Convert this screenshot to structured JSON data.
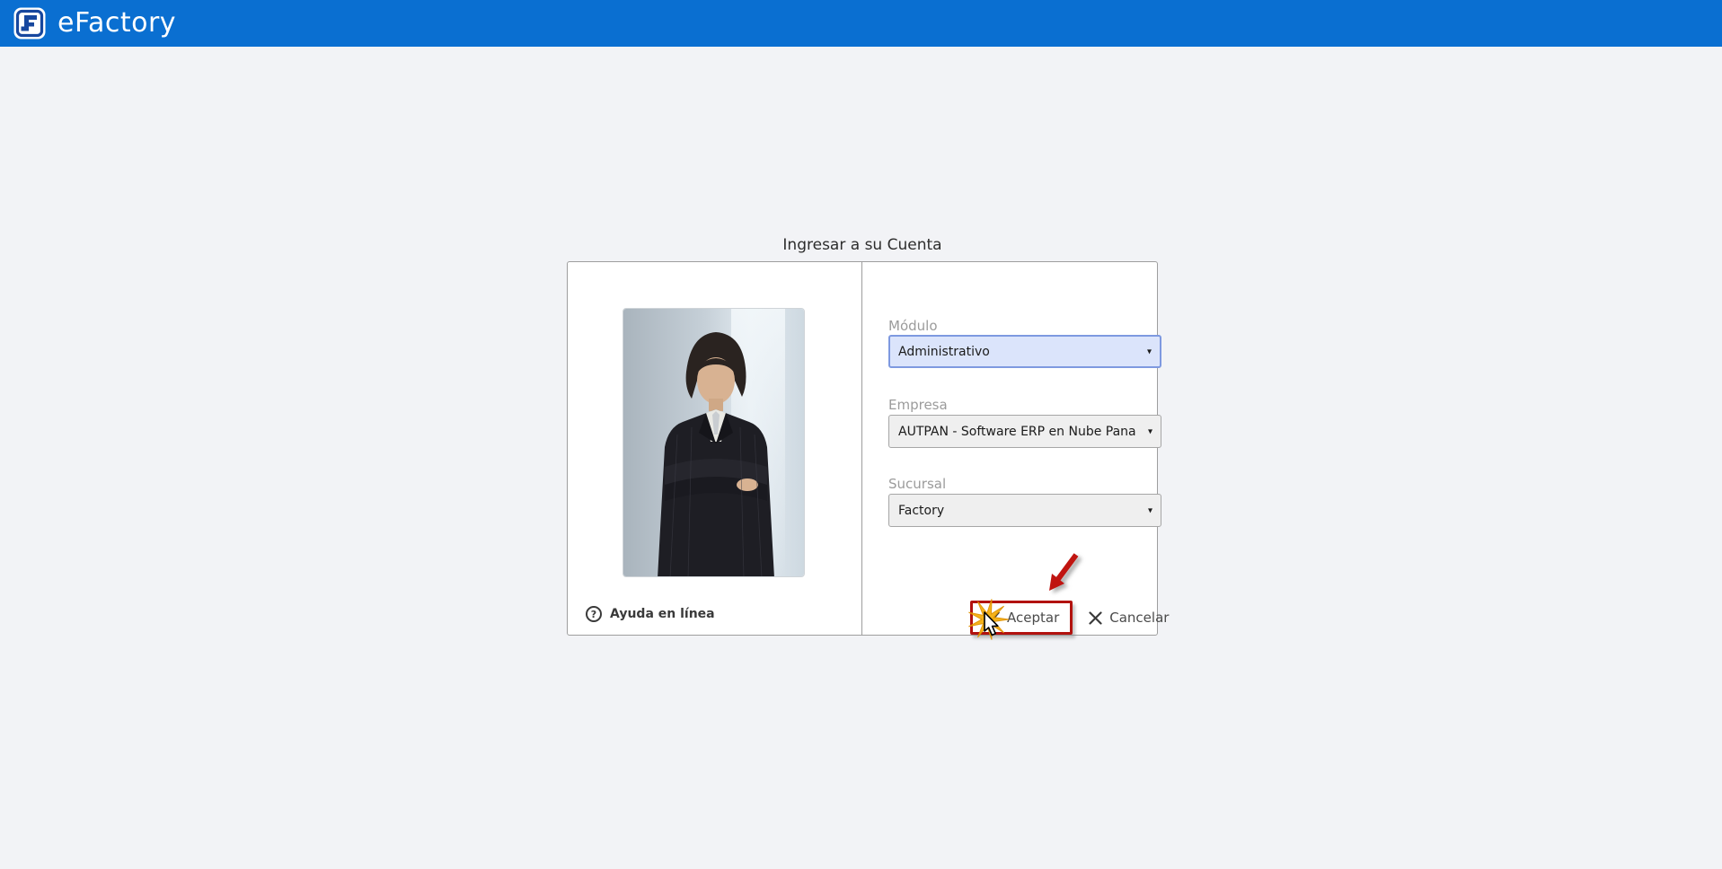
{
  "header": {
    "brand": "eFactory"
  },
  "login": {
    "title": "Ingresar a su Cuenta",
    "fields": [
      {
        "label": "Módulo",
        "value": "Administrativo",
        "state": "focused"
      },
      {
        "label": "Empresa",
        "value": "AUTPAN - Software ERP en Nube Pana",
        "state": "default"
      },
      {
        "label": "Sucursal",
        "value": "Factory",
        "state": "default"
      }
    ],
    "actions": {
      "accept": "Aceptar",
      "cancel": "Cancelar"
    },
    "help_label": "Ayuda en línea"
  },
  "icons": {
    "logo": "eFactory-mark",
    "help": "?",
    "accept": "checkmark",
    "cancel": "x-mark",
    "select_arrow": "▾"
  },
  "colors": {
    "header_blue": "#0a6fd1",
    "logo_navy": "#17479e",
    "page_bg": "#f2f3f6",
    "card_border": "#9e9e9e",
    "label_gray": "#9b9b9b",
    "focused_select_bg": "#dbe4fb",
    "focused_select_border": "#7e99e0",
    "select_bg": "#efefef",
    "annotation_red": "#b2120e",
    "arrow_red": "#c01410",
    "starburst_gold": "#f5af0e"
  }
}
